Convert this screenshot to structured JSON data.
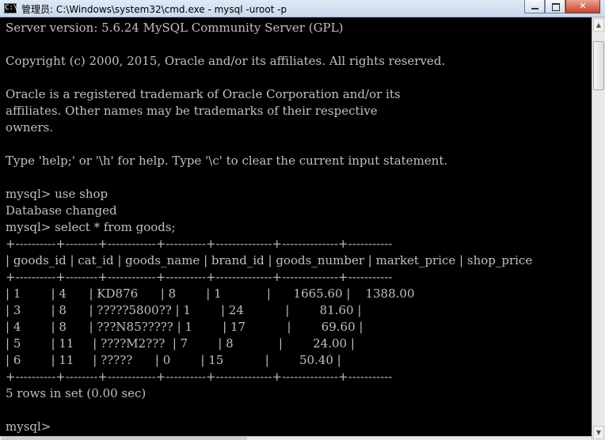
{
  "window": {
    "icon": "C:\\",
    "title": "管理员: C:\\Windows\\system32\\cmd.exe - mysql  -uroot -p"
  },
  "console": {
    "lines": [
      "Server version: 5.6.24 MySQL Community Server (GPL)",
      "",
      "Copyright (c) 2000, 2015, Oracle and/or its affiliates. All rights reserved.",
      "",
      "Oracle is a registered trademark of Oracle Corporation and/or its",
      "affiliates. Other names may be trademarks of their respective",
      "owners.",
      "",
      "Type 'help;' or '\\h' for help. Type '\\c' to clear the current input statement.",
      "",
      "mysql> use shop",
      "Database changed",
      "mysql> select * from goods;",
      "+----------+--------+------------+----------+--------------+--------------+-----------",
      "| goods_id | cat_id | goods_name | brand_id | goods_number | market_price | shop_price",
      "+----------+--------+------------+----------+--------------+--------------+-----------",
      "| 1        | 4      | KD876      | 8        | 1            |      1665.60 |    1388.00",
      "| 3        | 8      | ?????5800?? | 1        | 24           |        81.60 |",
      "| 4        | 8      | ???N85????? | 1        | 17           |        69.60 |",
      "| 5        | 11     | ????M2???  | 7        | 8            |        24.00 |",
      "| 6        | 11     | ?????      | 0        | 15           |        50.40 |",
      "+----------+--------+------------+----------+--------------+--------------+-----------",
      "5 rows in set (0.00 sec)",
      "",
      "mysql>"
    ]
  },
  "icons": {
    "minimize": "minimize-icon",
    "maximize": "maximize-icon",
    "close": "close-icon",
    "scroll_up": "▲",
    "scroll_down": "▼"
  }
}
